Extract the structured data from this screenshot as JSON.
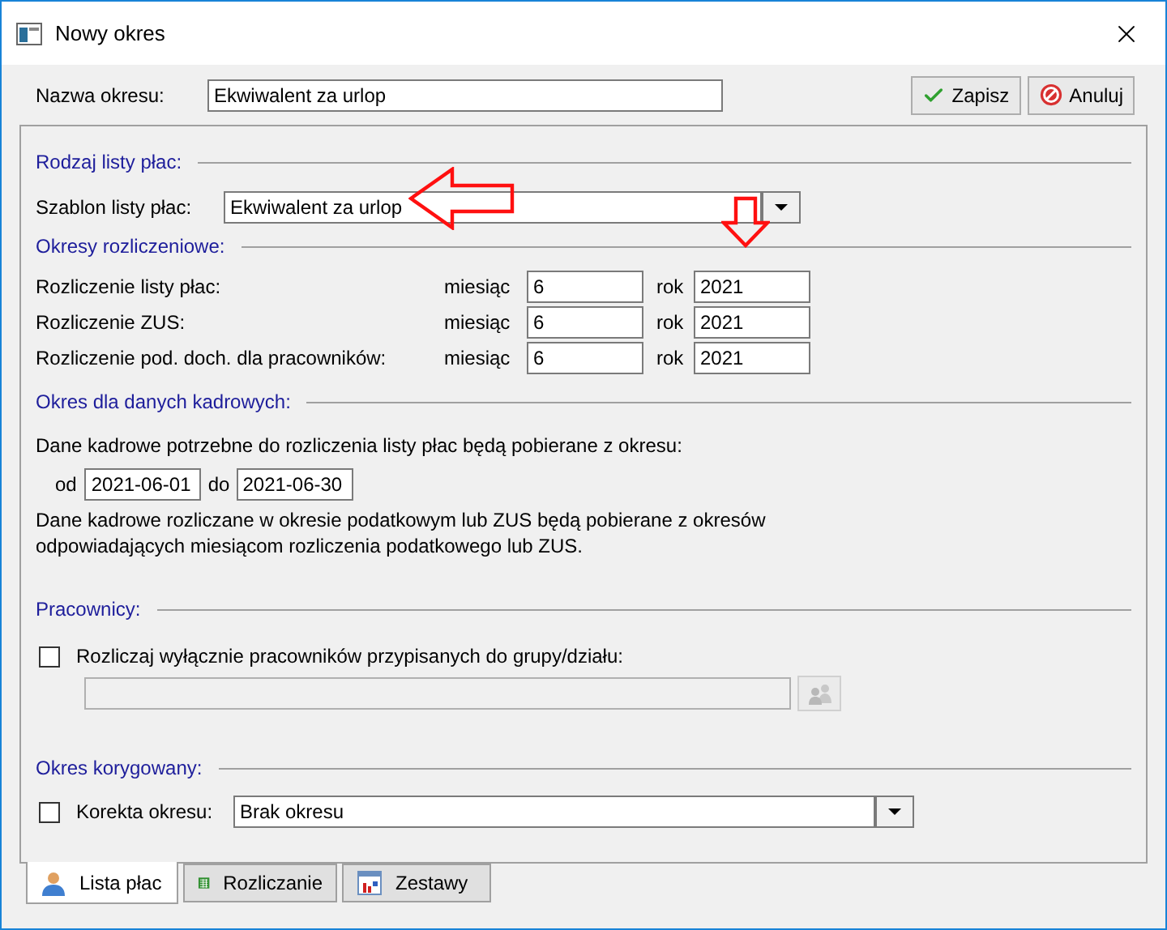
{
  "window": {
    "title": "Nowy okres"
  },
  "name_field": {
    "label": "Nazwa okresu:",
    "value": "Ekwiwalent za urlop"
  },
  "buttons": [
    {
      "label": "Zapisz",
      "kind": "save"
    },
    {
      "label": "Anuluj",
      "kind": "cancel"
    }
  ],
  "payroll_type": {
    "heading": "Rodzaj listy płac:",
    "template_label": "Szablon listy płac:",
    "template_value": "Ekwiwalent za urlop"
  },
  "settlement_periods": {
    "heading": "Okresy rozliczeniowe:",
    "rows": [
      {
        "label": "Rozliczenie listy płac:",
        "month_label": "miesiąc",
        "month": "6",
        "year_label": "rok",
        "year": "2021"
      },
      {
        "label": "Rozliczenie ZUS:",
        "month_label": "miesiąc",
        "month": "6",
        "year_label": "rok",
        "year": "2021"
      },
      {
        "label": "Rozliczenie pod. doch. dla pracowników:",
        "month_label": "miesiąc",
        "month": "6",
        "year_label": "rok",
        "year": "2021"
      }
    ]
  },
  "hr_period": {
    "heading": "Okres dla danych kadrowych:",
    "intro": "Dane kadrowe potrzebne do rozliczenia listy płac będą pobierane z okresu:",
    "from_label": "od",
    "from": "2021-06-01",
    "to_label": "do",
    "to": "2021-06-30",
    "note": "Dane kadrowe rozliczane w okresie podatkowym lub ZUS będą pobierane z okresów\nodpowiadających miesiącom rozliczenia podatkowego lub ZUS."
  },
  "employees": {
    "heading": "Pracownicy:",
    "checkbox": {
      "label": "Rozliczaj wyłącznie pracowników przypisanych do grupy/działu:",
      "checked": false
    },
    "group_field": {
      "disabled": true
    }
  },
  "corrected_period": {
    "heading": "Okres korygowany:",
    "checkbox": {
      "label": "Korekta okresu:",
      "checked": false
    },
    "value": "Brak okresu"
  },
  "tabs": [
    {
      "label": "Lista płac",
      "selected": true,
      "kind": "person"
    },
    {
      "label": "Rozliczanie",
      "selected": false,
      "kind": "sheet"
    },
    {
      "label": "Zestawy",
      "selected": false,
      "kind": "chart"
    }
  ]
}
